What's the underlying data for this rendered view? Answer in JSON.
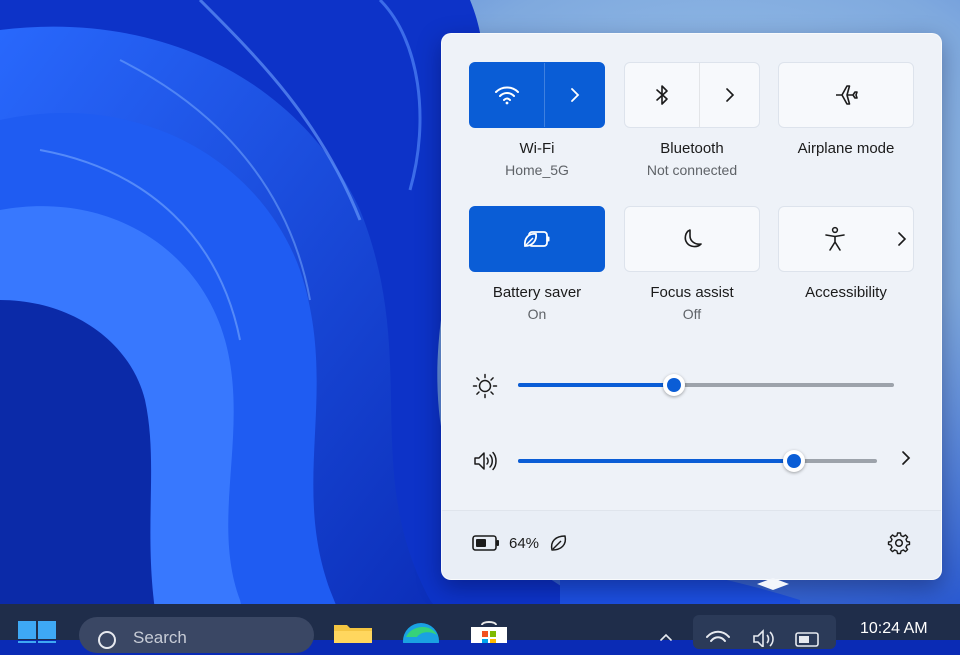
{
  "quick_settings": {
    "tiles": [
      {
        "label": "Wi-Fi",
        "sublabel": "Home_5G",
        "state": "on",
        "icon": "wifi-icon",
        "has_arrow": true
      },
      {
        "label": "Bluetooth",
        "sublabel": "Not connected",
        "state": "off",
        "icon": "bluetooth-icon",
        "has_arrow": true
      },
      {
        "label": "Airplane mode",
        "sublabel": "",
        "state": "off",
        "icon": "airplane-icon",
        "has_arrow": false
      },
      {
        "label": "Battery saver",
        "sublabel": "On",
        "state": "on",
        "icon": "battery-saver-icon",
        "has_arrow": false
      },
      {
        "label": "Focus assist",
        "sublabel": "Off",
        "state": "off",
        "icon": "moon-icon",
        "has_arrow": false
      },
      {
        "label": "Accessibility",
        "sublabel": "",
        "state": "off",
        "icon": "accessibility-icon",
        "has_arrow": true
      }
    ],
    "brightness": {
      "icon": "sun-icon",
      "value_fraction": 0.415
    },
    "volume": {
      "icon": "speaker-icon",
      "value_fraction": 0.77
    },
    "battery": {
      "percent_text": "64%",
      "icon": "battery-icon",
      "saver_icon": "leaf-icon"
    },
    "settings_icon": "gear-icon"
  },
  "taskbar": {
    "search_placeholder": "Search",
    "clock": "10:24 AM",
    "apps": [
      "file-explorer-icon",
      "edge-icon",
      "store-icon"
    ],
    "tray_icons": [
      "wifi-icon",
      "speaker-icon",
      "battery-icon"
    ]
  },
  "colors": {
    "accent": "#0a5dd6",
    "panel_bg": "#eef2f8",
    "taskbar_bg": "#1f2d4a"
  }
}
